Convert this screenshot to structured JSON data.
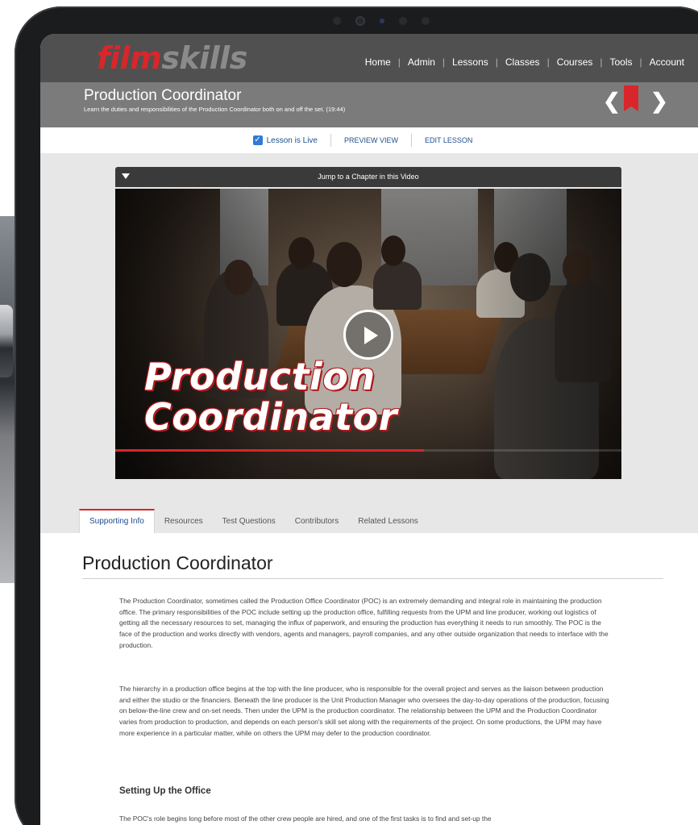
{
  "header": {
    "logo_part1": "film",
    "logo_part2": "skills",
    "nav": [
      "Home",
      "Admin",
      "Lessons",
      "Classes",
      "Courses",
      "Tools",
      "Account"
    ]
  },
  "lesson": {
    "title": "Production Coordinator",
    "subtitle": "Learn the duties and responsibilities of the Production Coordinator both on and off the set. (19:44)"
  },
  "controls": {
    "live_label": "Lesson is Live",
    "live_checked": true,
    "preview_label": "PREVIEW VIEW",
    "edit_label": "EDIT LESSON"
  },
  "video": {
    "chapter_label": "Jump to a Chapter in this Video",
    "overlay_line1": "Production",
    "overlay_line2": "Coordinator",
    "progress_fraction": 0.61
  },
  "tabs": [
    "Supporting Info",
    "Resources",
    "Test Questions",
    "Contributors",
    "Related Lessons"
  ],
  "active_tab": "Supporting Info",
  "content": {
    "heading": "Production Coordinator",
    "paragraph1": "The Production Coordinator, sometimes called the Production Office Coordinator (POC) is an extremely demanding and integral role in maintaining the production office. The primary responsibilities of the POC include setting up the production office, fulfilling requests from the UPM and line producer, working out logistics of getting all the necessary resources to set, managing the influx of paperwork, and ensuring the production has everything it needs to run smoothly. The POC is the face of the production and works directly with vendors, agents and managers, payroll companies, and any other outside organization that needs to interface with the production.",
    "paragraph2": "The hierarchy in a production office begins at the top with the line producer, who is responsible for the overall project and serves as the liaison between production and either the studio or the financiers. Beneath the line producer is the Unit Production Manager who oversees the day-to-day operations of the production, focusing on below-the-line crew and on-set needs. Then under the UPM is the production coordinator. The relationship between the UPM and the Production Coordinator varies from production to production, and depends on each person's skill set along with the requirements of the project. On some productions, the UPM may have more experience in a particular matter, while on others the UPM may defer to the production coordinator.",
    "subheading": "Setting Up the Office",
    "paragraph3": "The POC's role begins long before most of the other crew people are hired, and one of the first tasks is to find and set-up the"
  },
  "colors": {
    "brand_red": "#d8262a",
    "topbar": "#505050",
    "titlebar": "#7b7b7b",
    "link_blue": "#1f4e8c"
  }
}
